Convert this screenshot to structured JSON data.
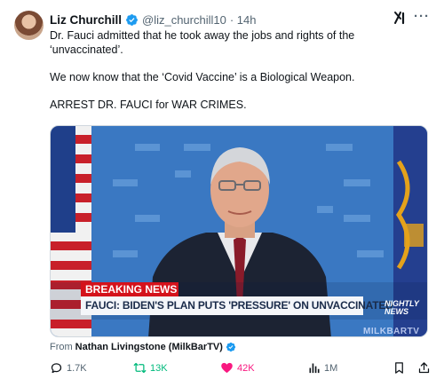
{
  "tweet": {
    "author_name": "Liz Churchill",
    "author_handle": "@liz_churchill10",
    "time": "· 14h",
    "lines": [
      "Dr. Fauci admitted that he took away the jobs and rights of the",
      "‘unvaccinated’.",
      "",
      "We now know that the ‘Covid Vaccine’ is a Biological Weapon.",
      "",
      "ARREST DR. FAUCI for WAR CRIMES."
    ]
  },
  "media": {
    "breaking_label": "BREAKING NEWS",
    "headline": "FAUCI: BIDEN'S PLAN PUTS 'PRESSURE' ON UNVACCINATED",
    "network_line1": "NIGHTLY",
    "network_line2": "NEWS",
    "watermark": "MILKBARTV"
  },
  "source": {
    "prefix": "From",
    "name": "Nathan Livingstone (MilkBarTV)"
  },
  "actions": {
    "replies": "1.7K",
    "reposts": "13K",
    "likes": "42K",
    "views": "1M"
  },
  "colors": {
    "verified": "#1d9bf0",
    "repost": "#00ba7c",
    "like": "#f91880",
    "muted": "#536471",
    "breaking": "#d4121b"
  }
}
